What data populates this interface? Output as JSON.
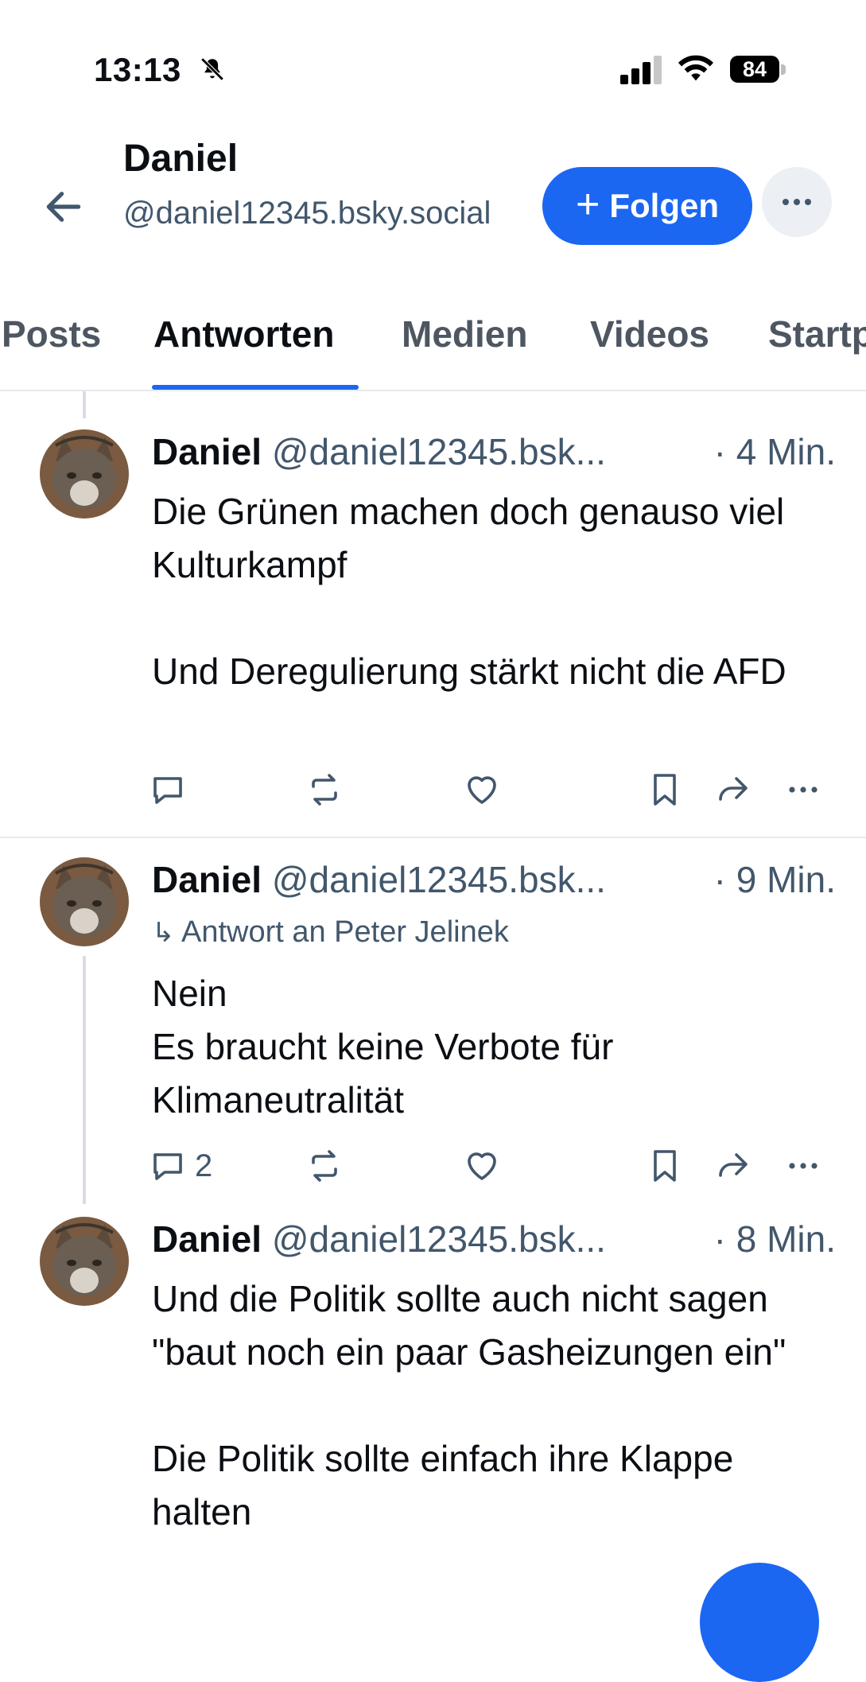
{
  "status_bar": {
    "time": "13:13",
    "battery": "84"
  },
  "header": {
    "name": "Daniel",
    "handle": "@daniel12345.bsky.social",
    "follow_label": "Folgen",
    "follow_icon": "plus-icon",
    "more_icon": "ellipsis-icon"
  },
  "tabs": [
    {
      "label": "Posts",
      "active": false
    },
    {
      "label": "Antworten",
      "active": true
    },
    {
      "label": "Medien",
      "active": false
    },
    {
      "label": "Videos",
      "active": false
    },
    {
      "label": "Startpakete",
      "active": false
    }
  ],
  "posts": [
    {
      "name": "Daniel",
      "handle": "@daniel12345.bsk...",
      "time": "· 4 Min.",
      "text": "Die Grünen machen doch genauso viel Kulturkampf\n\nUnd Deregulierung stärkt nicht die AFD",
      "reply_count": ""
    },
    {
      "name": "Daniel",
      "handle": "@daniel12345.bsk...",
      "time": "· 9 Min.",
      "reply_to": "Antwort an Peter Jelinek",
      "text": "Nein\nEs braucht keine Verbote für Klimaneutralität",
      "reply_count": "2"
    },
    {
      "name": "Daniel",
      "handle": "@daniel12345.bsk...",
      "time": "· 8 Min.",
      "text": "Und die Politik sollte auch nicht sagen \"baut noch ein paar Gasheizungen ein\"\n\nDie Politik sollte einfach ihre Klappe halten"
    }
  ],
  "colors": {
    "accent": "#1b67f2",
    "muted": "#42576c",
    "divider": "#e6e9ee"
  }
}
